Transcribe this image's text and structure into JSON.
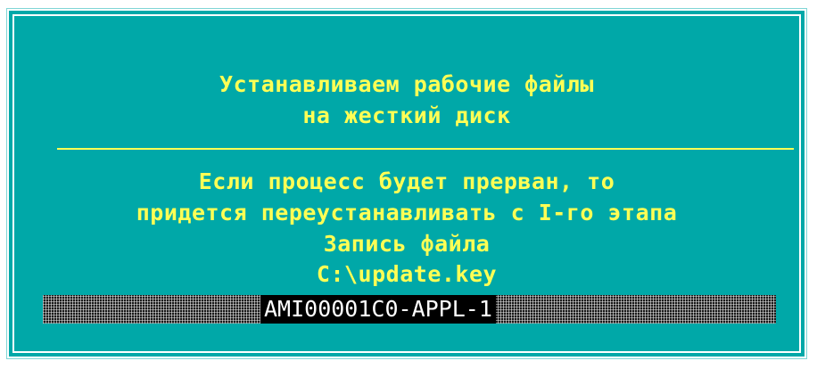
{
  "dialog": {
    "title_line1": "Устанавливаем рабочие файлы",
    "title_line2": "на жесткий диск",
    "warning_line1": "Если процесс будет прерван, то",
    "warning_line2": "придется переустанавливать с I-го этапа",
    "status_label": "Запись файла",
    "file_path": "C:\\update.key",
    "progress_text": "AMI00001C0-APPL-1"
  },
  "colors": {
    "background": "#00a8a8",
    "text": "#ffff55",
    "border": "#ffffff",
    "progress_label_bg": "#000000"
  }
}
